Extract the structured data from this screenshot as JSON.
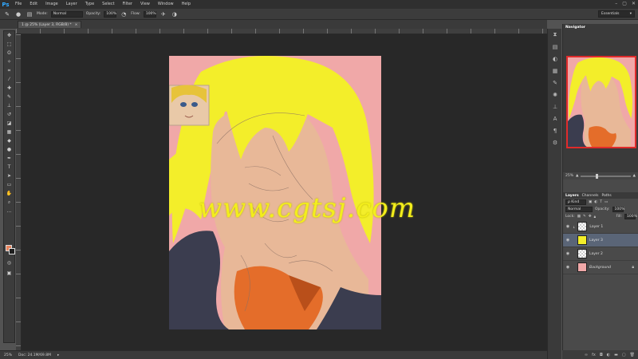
{
  "app": {
    "logo": "Ps",
    "menus": [
      "File",
      "Edit",
      "Image",
      "Layer",
      "Type",
      "Select",
      "Filter",
      "View",
      "Window",
      "Help"
    ],
    "window_controls": [
      "–",
      "▢",
      "✕"
    ]
  },
  "options": {
    "mode_label": "Mode:",
    "mode_value": "Normal",
    "opacity_label": "Opacity:",
    "opacity_value": "100%",
    "flow_label": "Flow:",
    "flow_value": "100%",
    "workspace": "Essentials"
  },
  "document": {
    "tab_title": "1 @ 25% (Layer 3, RGB/8) *",
    "tab_close": "×",
    "watermark": "www.cgtsj.com"
  },
  "status": {
    "zoom": "25%",
    "doc": "Doc: 24.1M/69.8M"
  },
  "navigator": {
    "tab": "Navigator",
    "zoom": "25%"
  },
  "layers_panel": {
    "tabs": [
      "Layers",
      "Channels",
      "Paths"
    ],
    "kind_label": "ρ Kind",
    "blend_mode": "Normal",
    "opacity_label": "Opacity:",
    "opacity_value": "100%",
    "lock_label": "Lock:",
    "fill_label": "Fill:",
    "fill_value": "100%",
    "layers": [
      {
        "name": "Layer 1",
        "selected": false
      },
      {
        "name": "Layer 3",
        "selected": true
      },
      {
        "name": "Layer 2",
        "selected": false
      },
      {
        "name": "Background",
        "selected": false
      }
    ]
  },
  "colors": {
    "foreground": "#e8855f",
    "background": "#1f1f1f",
    "canvas_bg": "#f0a8a8",
    "hair": "#f3ee2a",
    "skin": "#e8b898",
    "jacket": "#3b3d4f",
    "shirt": "#e46d2a",
    "watermark": "#f3ee1c"
  }
}
